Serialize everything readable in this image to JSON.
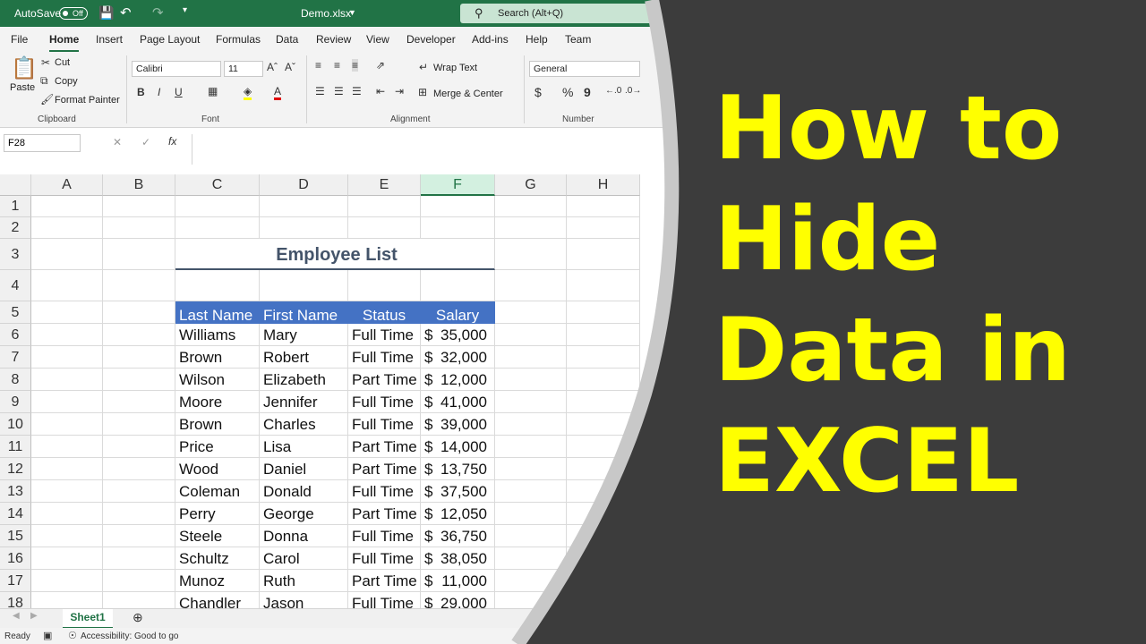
{
  "titlebar": {
    "autosave_label": "AutoSave",
    "autosave_state": "Off",
    "filename": "Demo.xlsx",
    "search_placeholder": "Search (Alt+Q)"
  },
  "menu": [
    "File",
    "Home",
    "Insert",
    "Page Layout",
    "Formulas",
    "Data",
    "Review",
    "View",
    "Developer",
    "Add-ins",
    "Help",
    "Team"
  ],
  "ribbon": {
    "paste": "Paste",
    "cut": "Cut",
    "copy": "Copy",
    "format_painter": "Format Painter",
    "clipboard": "Clipboard",
    "font_name": "Calibri",
    "font_size": "11",
    "font": "Font",
    "wrap_text": "Wrap Text",
    "merge_center": "Merge & Center",
    "alignment": "Alignment",
    "number_format": "General",
    "number": "Number",
    "bold": "B",
    "italic": "I",
    "underline": "U",
    "currency": "$",
    "percent": "%",
    "comma": "9"
  },
  "formula_bar": {
    "name_box": "F28",
    "fx": "fx"
  },
  "columns": [
    "A",
    "B",
    "C",
    "D",
    "E",
    "F",
    "G",
    "H"
  ],
  "rows": [
    "1",
    "2",
    "3",
    "4",
    "5",
    "6",
    "7",
    "8",
    "9",
    "10",
    "11",
    "12",
    "13",
    "14",
    "15",
    "16",
    "17",
    "18"
  ],
  "table": {
    "title": "Employee List",
    "headers": [
      "Last Name",
      "First Name",
      "Status",
      "Salary"
    ],
    "currency_symbol": "$",
    "data": [
      [
        "Williams",
        "Mary",
        "Full Time",
        "35,000"
      ],
      [
        "Brown",
        "Robert",
        "Full Time",
        "32,000"
      ],
      [
        "Wilson",
        "Elizabeth",
        "Part Time",
        "12,000"
      ],
      [
        "Moore",
        "Jennifer",
        "Full Time",
        "41,000"
      ],
      [
        "Brown",
        "Charles",
        "Full Time",
        "39,000"
      ],
      [
        "Price",
        "Lisa",
        "Part Time",
        "14,000"
      ],
      [
        "Wood",
        "Daniel",
        "Part Time",
        "13,750"
      ],
      [
        "Coleman",
        "Donald",
        "Full Time",
        "37,500"
      ],
      [
        "Perry",
        "George",
        "Part Time",
        "12,050"
      ],
      [
        "Steele",
        "Donna",
        "Full Time",
        "36,750"
      ],
      [
        "Schultz",
        "Carol",
        "Full Time",
        "38,050"
      ],
      [
        "Munoz",
        "Ruth",
        "Part Time",
        "11,000"
      ],
      [
        "Chandler",
        "Jason",
        "Full Time",
        "29,000"
      ]
    ]
  },
  "sheet_tab": "Sheet1",
  "status": {
    "ready": "Ready",
    "accessibility": "Accessibility: Good to go"
  },
  "headline": [
    "How to",
    "Hide",
    "Data in",
    "EXCEL"
  ],
  "colors": {
    "excel_green": "#217346",
    "table_header": "#4472c4",
    "headline": "#ffff00",
    "background": "#3c3c3c"
  }
}
